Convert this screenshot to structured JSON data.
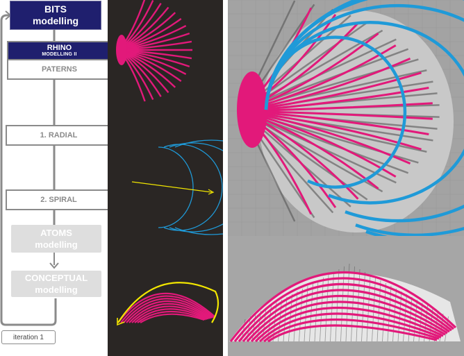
{
  "flow": {
    "bits": {
      "line1": "BITS",
      "line2": "modelling"
    },
    "rhino": {
      "line1": "RHINO",
      "line2": "MODELLING II"
    },
    "patterns": "PATERNS",
    "step1": "1. RADIAL",
    "step2": "2. SPIRAL",
    "atoms": {
      "line1": "ATOMS",
      "line2": "modelling"
    },
    "conceptual": {
      "line1": "CONCEPTUAL",
      "line2": "modelling"
    },
    "iteration": "iteration  1"
  },
  "colors": {
    "navy": "#1f1f6e",
    "magenta": "#e2197a",
    "cyan": "#1f9ad8",
    "yellow": "#f2e600",
    "connector": "#8a8a8a",
    "dark_panel": "#2a2624",
    "viewport_bg": "#a3a3a3"
  },
  "icons": [
    "loop-arrow-icon",
    "down-arrow-icon",
    "dotted-connector-arrow-icon"
  ]
}
